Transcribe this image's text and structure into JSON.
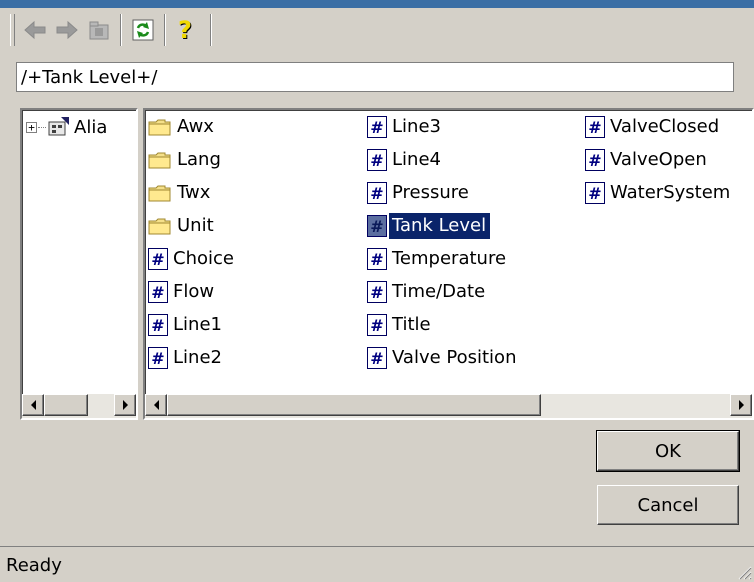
{
  "toolbar": {
    "back_icon": "arrow-left-icon",
    "forward_icon": "arrow-right-icon",
    "folder_up_icon": "folder-up-icon",
    "refresh_icon": "refresh-icon",
    "help_icon": "help-icon"
  },
  "path": {
    "value": "/+Tank Level+/"
  },
  "tree": {
    "root_label": "Alia"
  },
  "list": {
    "items": [
      {
        "label": "Awx",
        "icon": "folder-icon"
      },
      {
        "label": "Lang",
        "icon": "folder-icon"
      },
      {
        "label": "Twx",
        "icon": "folder-icon"
      },
      {
        "label": "Unit",
        "icon": "folder-icon"
      },
      {
        "label": "Choice",
        "icon": "tag-icon"
      },
      {
        "label": "Flow",
        "icon": "tag-icon"
      },
      {
        "label": "Line1",
        "icon": "tag-icon"
      },
      {
        "label": "Line2",
        "icon": "tag-icon"
      },
      {
        "label": "Line3",
        "icon": "tag-icon"
      },
      {
        "label": "Line4",
        "icon": "tag-icon"
      },
      {
        "label": "Pressure",
        "icon": "tag-icon"
      },
      {
        "label": "Tank Level",
        "icon": "tag-icon",
        "selected": true
      },
      {
        "label": "Temperature",
        "icon": "tag-icon"
      },
      {
        "label": "Time/Date",
        "icon": "tag-icon"
      },
      {
        "label": "Title",
        "icon": "tag-icon"
      },
      {
        "label": "Valve Position",
        "icon": "tag-icon"
      },
      {
        "label": "ValveClosed",
        "icon": "tag-icon"
      },
      {
        "label": "ValveOpen",
        "icon": "tag-icon"
      },
      {
        "label": "WaterSystem",
        "icon": "tag-icon"
      }
    ]
  },
  "buttons": {
    "ok": "OK",
    "cancel": "Cancel"
  },
  "status": {
    "text": "Ready"
  },
  "colors": {
    "selection": "#0a246a",
    "face": "#d4d0c8",
    "tag_icon": "#000080"
  }
}
